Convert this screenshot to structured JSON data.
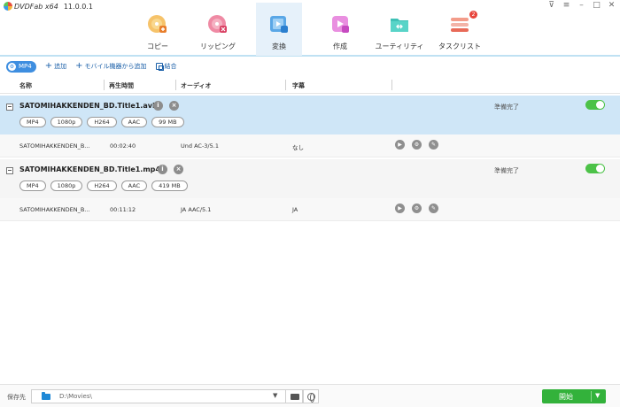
{
  "app": {
    "title": "DVDFab x64",
    "version": "11.0.0.1"
  },
  "window_controls": [
    "pin",
    "menu",
    "minimize",
    "maximize",
    "close"
  ],
  "nav": {
    "tabs": [
      {
        "label": "コピー",
        "icon": "copy-disc-icon",
        "active": false
      },
      {
        "label": "リッピング",
        "icon": "ripper-disc-icon",
        "active": false
      },
      {
        "label": "変換",
        "icon": "converter-icon",
        "active": true
      },
      {
        "label": "作成",
        "icon": "creator-icon",
        "active": false
      },
      {
        "label": "ユーティリティ",
        "icon": "utilities-icon",
        "active": false
      },
      {
        "label": "タスクリスト",
        "icon": "task-list-icon",
        "active": false,
        "badge": "2"
      }
    ]
  },
  "toolbar": {
    "format": "MP4",
    "add": "追加",
    "mobile_add": "モバイル機器から追加",
    "merge": "結合"
  },
  "columns": {
    "name": "名称",
    "duration": "再生時間",
    "audio": "オーディオ",
    "subtitle": "字幕"
  },
  "files": [
    {
      "name": "SATOMIHAKKENDEN_BD.Title1.avi",
      "chips": [
        "MP4",
        "1080p",
        "H264",
        "AAC",
        "99 MB"
      ],
      "status": "準備完了",
      "track": {
        "name": "SATOMIHAKKENDEN_B...",
        "duration": "00:02:40",
        "audio": "Und AC-3/5.1",
        "subtitle": "なし"
      }
    },
    {
      "name": "SATOMIHAKKENDEN_BD.Title1.mp4",
      "chips": [
        "MP4",
        "1080p",
        "H264",
        "AAC",
        "419 MB"
      ],
      "status": "準備完了",
      "track": {
        "name": "SATOMIHAKKENDEN_B...",
        "duration": "00:11:12",
        "audio": "JA AAC/5.1",
        "subtitle": "JA"
      }
    }
  ],
  "footer": {
    "save_label": "保存先",
    "path": "D:\\Movies\\",
    "start": "開始"
  },
  "colors": {
    "accent": "#3e8ee0",
    "selected_row": "#cfe6f7",
    "start_button": "#33b23b",
    "toggle": "#4cc248",
    "badge": "#e8453c"
  }
}
